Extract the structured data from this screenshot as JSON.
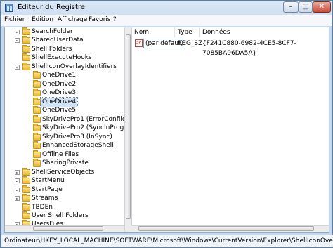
{
  "window": {
    "title": "Éditeur du Registre"
  },
  "menu": [
    {
      "label": "Fichier"
    },
    {
      "label": "Edition"
    },
    {
      "label": "Affichage"
    },
    {
      "label": "Favoris"
    },
    {
      "label": "?"
    }
  ],
  "tree": [
    {
      "label": "SearchFolder"
    },
    {
      "label": "SharedUserData"
    },
    {
      "label": "Shell Folders"
    },
    {
      "label": "ShellExecuteHooks"
    },
    {
      "label": "ShellIconOverlayIdentifiers"
    },
    {
      "label": "OneDrive1"
    },
    {
      "label": "OneDrive2"
    },
    {
      "label": "OneDrive3"
    },
    {
      "label": "OneDrive4"
    },
    {
      "label": "OneDrive5"
    },
    {
      "label": "SkyDrivePro1 (ErrorConflict)"
    },
    {
      "label": "SkyDrivePro2 (SyncInProgress)"
    },
    {
      "label": "SkyDrivePro3 (InSync)"
    },
    {
      "label": "EnhancedStorageShell"
    },
    {
      "label": "Offline Files"
    },
    {
      "label": "SharingPrivate"
    },
    {
      "label": "ShellServiceObjects"
    },
    {
      "label": "StartMenu"
    },
    {
      "label": "StartPage"
    },
    {
      "label": "Streams"
    },
    {
      "label": "TBDEn"
    },
    {
      "label": "User Shell Folders"
    },
    {
      "label": "UsersFiles"
    }
  ],
  "list": {
    "columns": [
      "Nom",
      "Type",
      "Données"
    ],
    "rows": [
      {
        "icon": "ab",
        "name": "(par défaut)",
        "type": "REG_SZ",
        "data": "{F241C880-6982-4CE5-8CF7-7085BA96DA5A}"
      }
    ]
  },
  "status": {
    "path": "Ordinateur\\HKEY_LOCAL_MACHINE\\SOFTWARE\\Microsoft\\Windows\\CurrentVersion\\Explorer\\ShellIconOverlayIdentifiers\\"
  }
}
